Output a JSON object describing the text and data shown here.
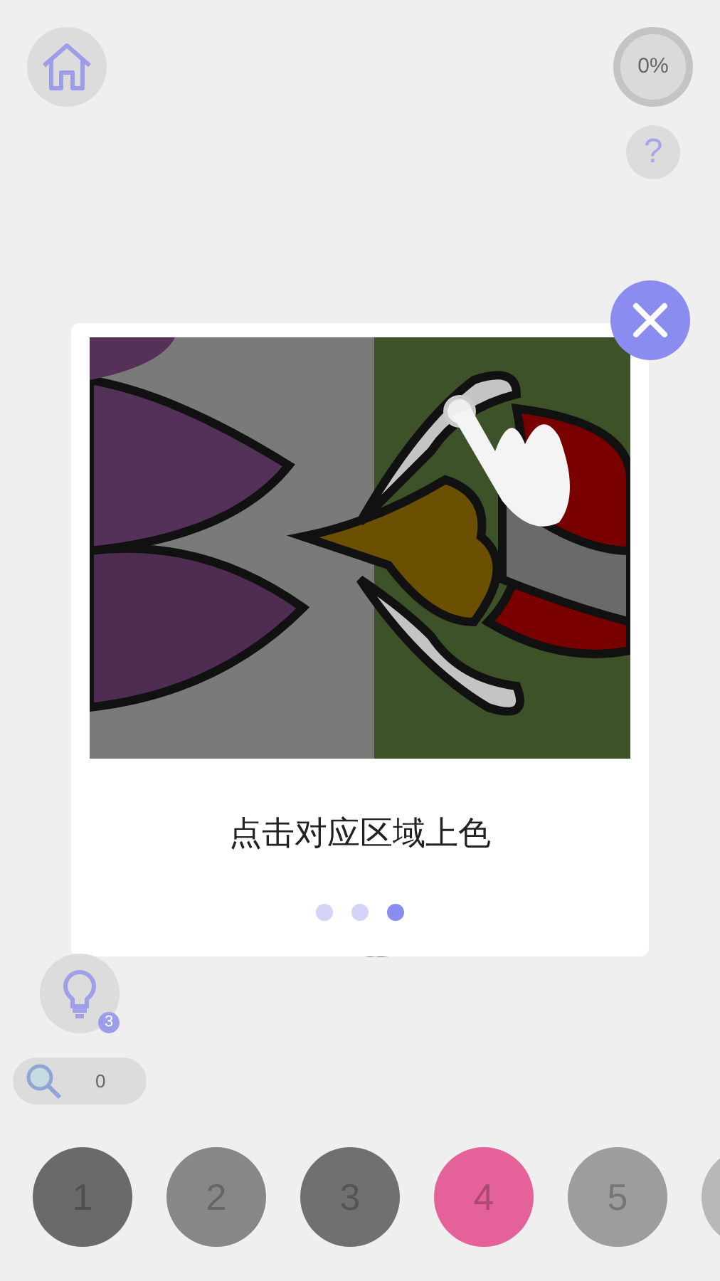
{
  "top_bar": {
    "progress": "0%",
    "help": "?"
  },
  "tutorial": {
    "caption": "点击对应区域上色",
    "pages": [
      {
        "selected": false
      },
      {
        "selected": false
      },
      {
        "selected": true
      }
    ]
  },
  "hint_button": {
    "count": "3"
  },
  "zoom": {
    "value": "0"
  },
  "palette": [
    {
      "label": "1",
      "color": "#6a6a6a"
    },
    {
      "label": "2",
      "color": "#878787"
    },
    {
      "label": "3",
      "color": "#707070"
    },
    {
      "label": "4",
      "color": "#e4619a"
    },
    {
      "label": "5",
      "color": "#9d9d9d"
    },
    {
      "color": "#b8b8b8"
    }
  ]
}
